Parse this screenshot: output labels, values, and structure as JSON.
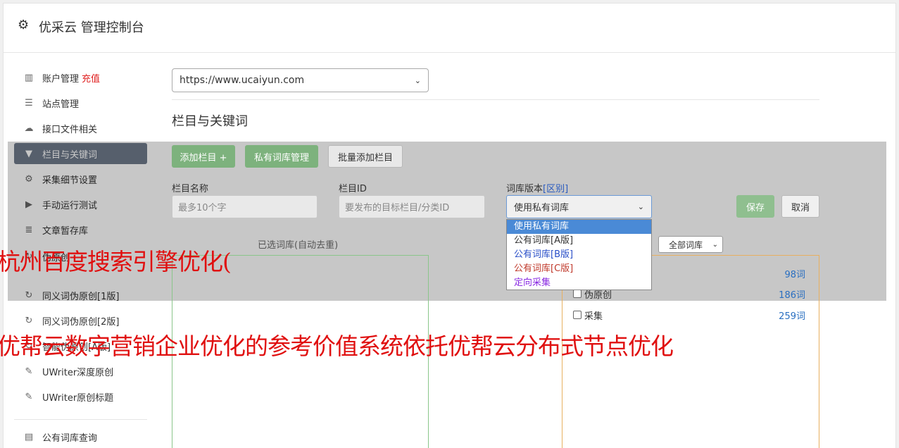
{
  "header": {
    "title": "优采云 管理控制台"
  },
  "sidebar": {
    "items": [
      {
        "label": "账户管理",
        "extra": "充值",
        "icon": "bar-chart-icon"
      },
      {
        "label": "站点管理",
        "icon": "server-icon"
      },
      {
        "label": "接口文件相关",
        "icon": "cloud-upload-icon"
      },
      {
        "label": "栏目与关键词",
        "icon": "filter-icon",
        "active": true
      },
      {
        "label": "采集细节设置",
        "icon": "cogs-icon"
      },
      {
        "label": "手动运行测试",
        "icon": "play-circle-icon"
      },
      {
        "label": "文章暂存库",
        "icon": "database-icon"
      },
      {
        "label": "伪原创",
        "icon": "refresh-icon"
      },
      {
        "label": "同义词伪原创[1版]",
        "icon": "refresh-icon"
      },
      {
        "label": "同义词伪原创[2版]",
        "icon": "refresh-icon"
      },
      {
        "label": "智能伪原创[A版]",
        "icon": "refresh-icon"
      },
      {
        "label": "UWriter深度原创",
        "icon": "edit-icon"
      },
      {
        "label": "UWriter原创标题",
        "icon": "edit-icon"
      },
      {
        "label": "公有词库查询",
        "icon": "book-icon"
      }
    ]
  },
  "main": {
    "site_select": "https://www.ucaiyun.com",
    "section_title": "栏目与关键词",
    "buttons": {
      "add_column": "添加栏目 +",
      "private_lib": "私有词库管理",
      "batch_add": "批量添加栏目",
      "save": "保存",
      "cancel": "取消"
    },
    "form": {
      "name_label": "栏目名称",
      "name_placeholder": "最多10个字",
      "id_label": "栏目ID",
      "id_placeholder": "要发布的目标栏目/分类ID",
      "version_label": "词库版本",
      "version_diff": "[区别]",
      "version_selected": "使用私有词库"
    },
    "version_options": [
      {
        "label": "使用私有词库",
        "color": "#ffffff"
      },
      {
        "label": "公有词库[A版]",
        "color": "#333333"
      },
      {
        "label": "公有词库[B版]",
        "color": "#2a4fc8"
      },
      {
        "label": "公有词库[C版]",
        "color": "#c0392b"
      },
      {
        "label": "定向采集",
        "color": "#8a2be2"
      }
    ],
    "chosen_label": "已选词库(自动去重)",
    "filter_select": "全部词库",
    "libraries": [
      {
        "label": "",
        "count": "98词"
      },
      {
        "label": "伪原创",
        "count": "186词"
      },
      {
        "label": "采集",
        "count": "259词"
      }
    ]
  },
  "watermark": {
    "line1": "杭州百度搜索引擎优化(",
    "line2": "优帮云数字营销企业优化的参考价值系统依托优帮云分布式节点优化"
  }
}
